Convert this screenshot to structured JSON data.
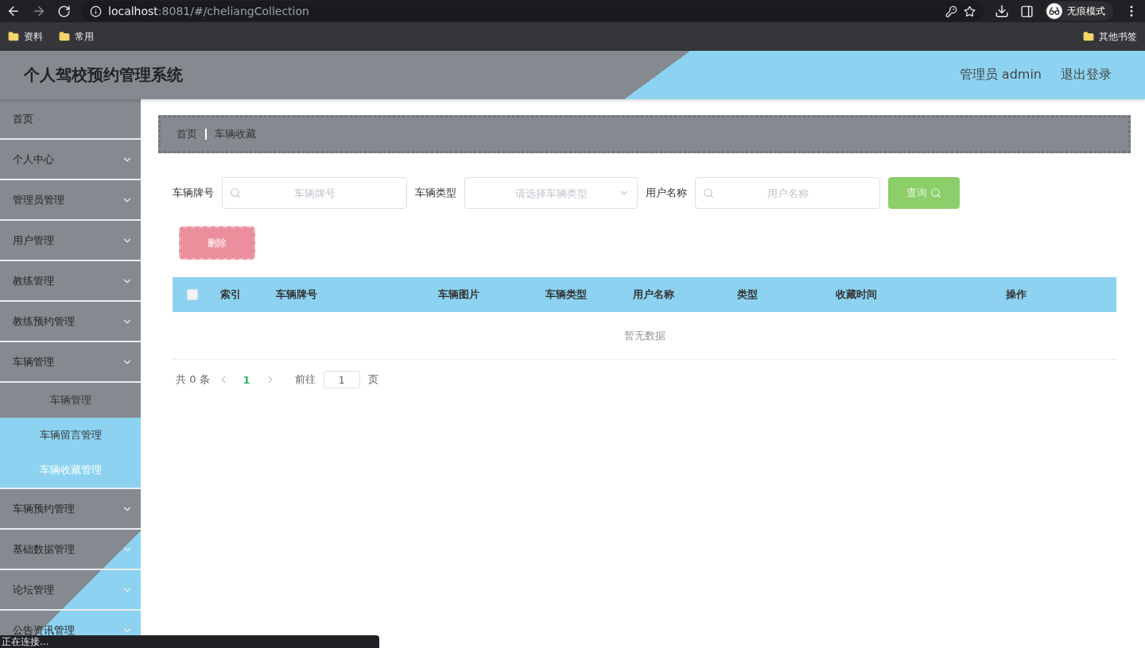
{
  "browser": {
    "url_host": "localhost",
    "url_rest": ":8081/#/cheliangCollection",
    "profile": "无痕模式",
    "bookmarks": [
      "资料",
      "常用"
    ],
    "other_bookmarks": "其他书签"
  },
  "header": {
    "title": "个人驾校预约管理系统",
    "user": "管理员 admin",
    "logout": "退出登录"
  },
  "sidebar": {
    "items": [
      {
        "label": "首页",
        "kind": "link"
      },
      {
        "label": "个人中心",
        "kind": "menu"
      },
      {
        "label": "管理员管理",
        "kind": "menu"
      },
      {
        "label": "用户管理",
        "kind": "menu"
      },
      {
        "label": "教练管理",
        "kind": "menu"
      },
      {
        "label": "教练预约管理",
        "kind": "menu"
      },
      {
        "label": "车辆管理",
        "kind": "menu",
        "children": [
          {
            "label": "车辆管理",
            "selected": false,
            "hovered": false
          },
          {
            "label": "车辆留言管理",
            "selected": false,
            "hovered": true
          },
          {
            "label": "车辆收藏管理",
            "selected": true,
            "hovered": false
          }
        ]
      },
      {
        "label": "车辆预约管理",
        "kind": "menu"
      },
      {
        "label": "基础数据管理",
        "kind": "menu"
      },
      {
        "label": "论坛管理",
        "kind": "menu"
      },
      {
        "label": "公告资讯管理",
        "kind": "menu"
      }
    ]
  },
  "breadcrumb": [
    "首页",
    "车辆收藏"
  ],
  "filters": [
    {
      "kind": "search",
      "label": "车辆牌号",
      "placeholder": "车辆牌号"
    },
    {
      "kind": "select",
      "label": "车辆类型",
      "placeholder": "请选择车辆类型"
    },
    {
      "kind": "search",
      "label": "用户名称",
      "placeholder": "用户名称"
    }
  ],
  "search_button": "查询",
  "delete_button": {
    "label": "删除",
    "disabled": true
  },
  "table": {
    "select_all": {
      "checked": false
    },
    "columns": [
      "索引",
      "车辆牌号",
      "车辆图片",
      "车辆类型",
      "用户名称",
      "类型",
      "收藏时间",
      "操作"
    ],
    "empty_text": "暂无数据"
  },
  "pagination": {
    "total": "共 0 条",
    "pages": [
      {
        "label": "1",
        "selected": true
      }
    ],
    "goto_label": "前往",
    "goto_value": "1",
    "page_unit": "页"
  },
  "status_text": "正在连接..."
}
